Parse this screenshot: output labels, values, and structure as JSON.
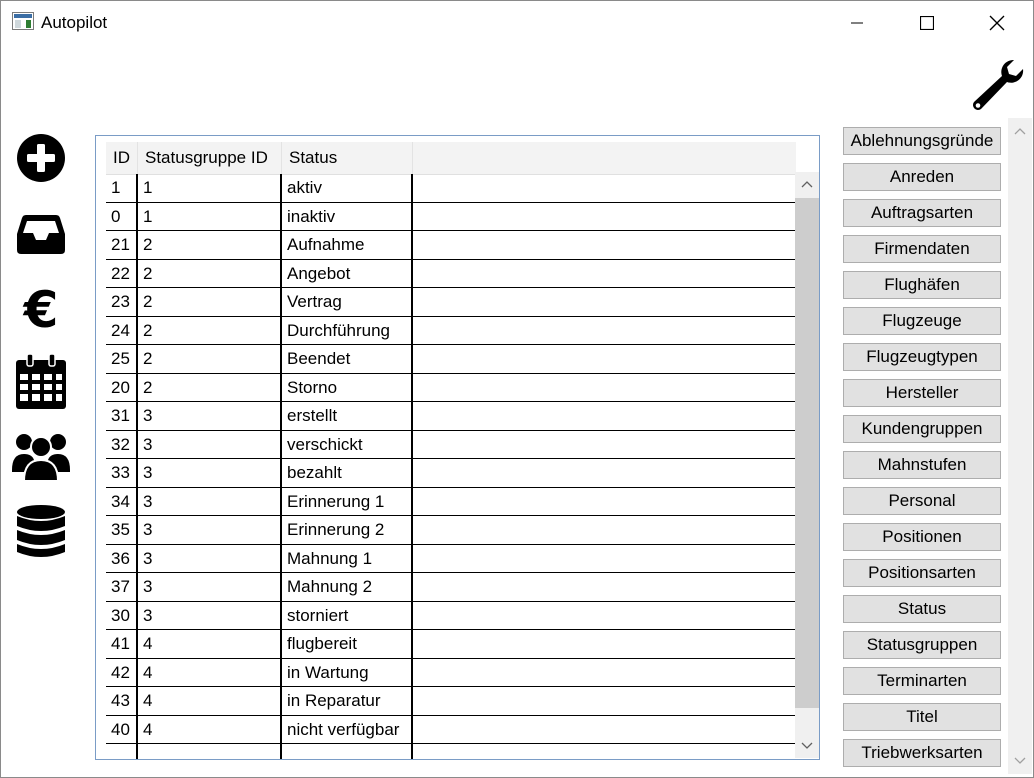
{
  "window": {
    "title": "Autopilot"
  },
  "icons": {
    "app": "app-icon",
    "settings": "wrench-icon",
    "sidebar": [
      "plus-circle-icon",
      "inbox-icon",
      "euro-icon",
      "calendar-icon",
      "users-icon",
      "database-icon"
    ]
  },
  "grid": {
    "columns": [
      "ID",
      "Statusgruppe ID",
      "Status"
    ],
    "rows": [
      [
        "1",
        "1",
        "aktiv"
      ],
      [
        "0",
        "1",
        "inaktiv"
      ],
      [
        "21",
        "2",
        "Aufnahme"
      ],
      [
        "22",
        "2",
        "Angebot"
      ],
      [
        "23",
        "2",
        "Vertrag"
      ],
      [
        "24",
        "2",
        "Durchführung"
      ],
      [
        "25",
        "2",
        "Beendet"
      ],
      [
        "20",
        "2",
        "Storno"
      ],
      [
        "31",
        "3",
        "erstellt"
      ],
      [
        "32",
        "3",
        "verschickt"
      ],
      [
        "33",
        "3",
        "bezahlt"
      ],
      [
        "34",
        "3",
        "Erinnerung 1"
      ],
      [
        "35",
        "3",
        "Erinnerung 2"
      ],
      [
        "36",
        "3",
        "Mahnung 1"
      ],
      [
        "37",
        "3",
        "Mahnung 2"
      ],
      [
        "30",
        "3",
        "storniert"
      ],
      [
        "41",
        "4",
        "flugbereit"
      ],
      [
        "42",
        "4",
        "in Wartung"
      ],
      [
        "43",
        "4",
        "in Reparatur"
      ],
      [
        "40",
        "4",
        "nicht verfügbar"
      ],
      [
        "",
        "",
        ""
      ]
    ]
  },
  "tables": [
    "Ablehnungsgründe",
    "Anreden",
    "Auftragsarten",
    "Firmendaten",
    "Flughäfen",
    "Flugzeuge",
    "Flugzeugtypen",
    "Hersteller",
    "Kundengruppen",
    "Mahnstufen",
    "Personal",
    "Positionen",
    "Positionsarten",
    "Status",
    "Statusgruppen",
    "Terminarten",
    "Titel",
    "Triebwerksarten"
  ]
}
